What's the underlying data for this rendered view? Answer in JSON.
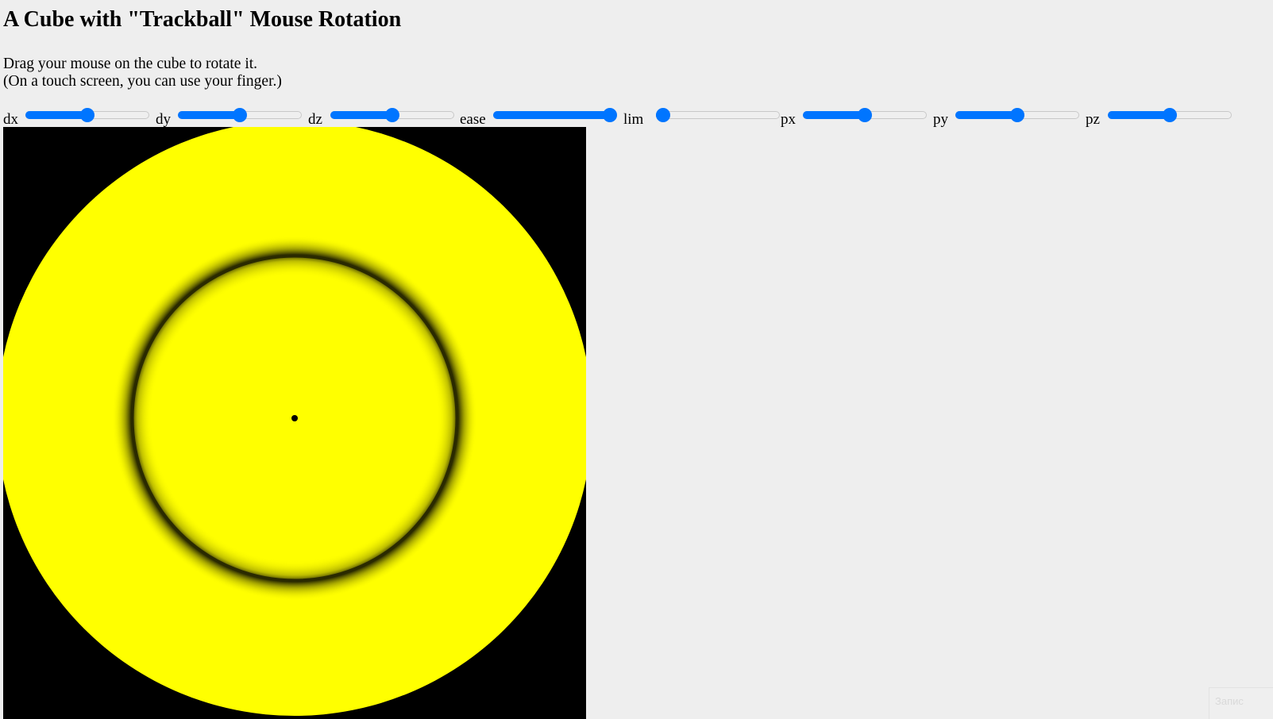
{
  "page": {
    "title": "A Cube with \"Trackball\" Mouse Rotation",
    "intro_line1": "Drag your mouse on the cube to rotate it.",
    "intro_line2": "(On a touch screen, you can use your finger.)"
  },
  "sliders": [
    {
      "label": "dx",
      "value": 0.5
    },
    {
      "label": "dy",
      "value": 0.5
    },
    {
      "label": "dz",
      "value": 0.5
    },
    {
      "label": "ease",
      "value": 1.0
    },
    {
      "label": "lim",
      "value": 0.0
    },
    {
      "label": "px",
      "value": 0.5
    },
    {
      "label": "py",
      "value": 0.5
    },
    {
      "label": "pz",
      "value": 0.5
    }
  ],
  "canvas": {
    "background_color": "#000000",
    "ball_color": "#ffff00",
    "ring_color": "#000000"
  },
  "colors": {
    "page_background": "#eeeeee",
    "slider_accent": "#0075ff"
  },
  "corner_widget": {
    "text": "Запис"
  }
}
